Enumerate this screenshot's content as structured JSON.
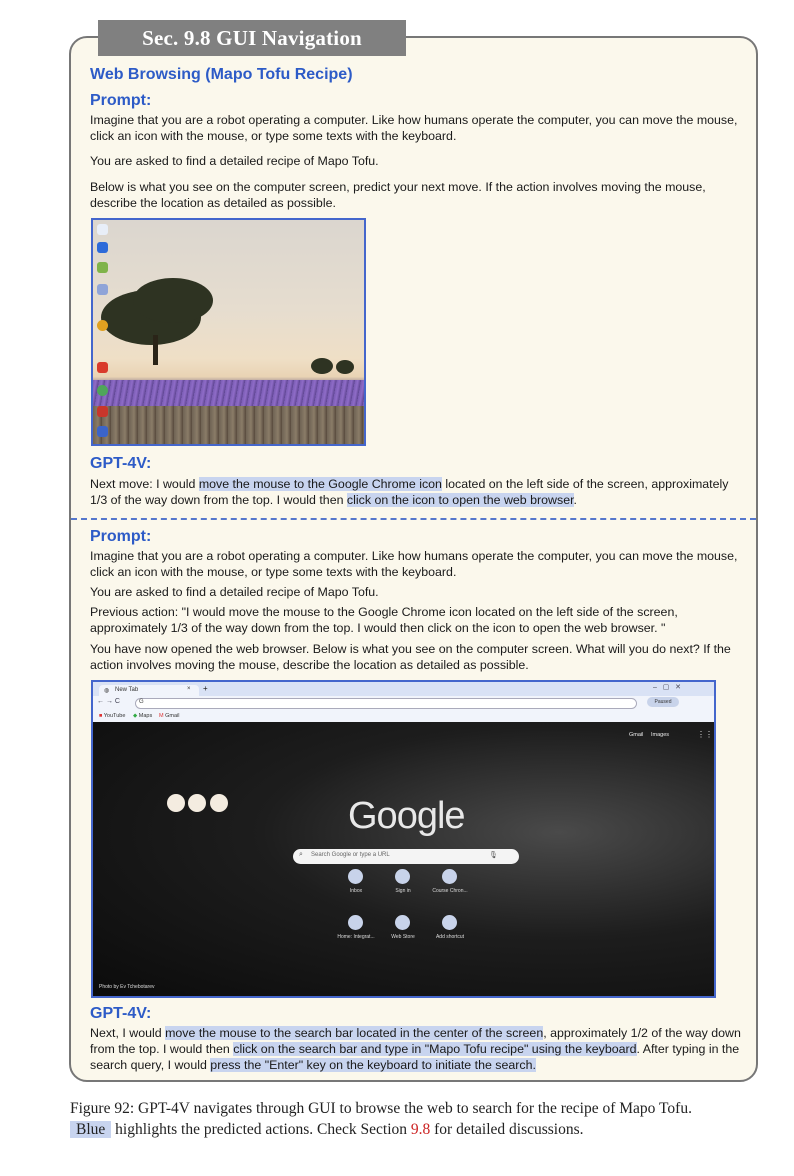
{
  "section_header": "Sec. 9.8 GUI Navigation",
  "task_title": "Web Browsing (Mapo Tofu Recipe)",
  "prompt_heading": "Prompt:",
  "gpt_heading": "GPT-4V:",
  "block1": {
    "p1": "Imagine that you are a robot operating a computer. Like how humans operate the computer, you can move the mouse, click an icon with the mouse, or type some texts with the keyboard.",
    "p2": "You are asked to find a detailed recipe of Mapo Tofu.",
    "p3": "Below is what you see on the computer screen, predict your next move. If the action involves moving the mouse, describe the location as detailed as possible.",
    "answer": {
      "a1": "Next move: I would ",
      "a2": "move the mouse to the Google Chrome icon",
      "a3": " located on the left side of the screen, approximately 1/3 of the way down from the top. I would then ",
      "a4": "click on the icon to open the web browser",
      "a5": "."
    }
  },
  "block2": {
    "p1": "Imagine that you are a robot operating a computer. Like how humans operate the computer, you can move the mouse, click an icon with the mouse, or type some texts with the keyboard.",
    "p2": "You are asked to find a detailed recipe of Mapo Tofu.",
    "p3": "Previous action: \"I would move the mouse to the Google Chrome icon located on the left side of the screen, approximately 1/3 of the way down from the top. I would then click on the icon to open the web browser. \"",
    "p4": "You have now opened the web browser. Below is what you see on the computer screen. What will you do next? If the action involves moving the mouse, describe the location as detailed as possible.",
    "answer": {
      "a1": "Next, I would ",
      "a2": "move the mouse to the search bar located in the center of the screen",
      "a3": ", approximately 1/2 of the way down from the top. I would then ",
      "a4": "click on the search bar and type in \"Mapo Tofu recipe\" using the keyboard",
      "a5": ". After typing in the search query, I would ",
      "a6": "press the \"Enter\" key on the keyboard to initiate the search."
    }
  },
  "browser": {
    "tab_title": "New Tab",
    "omni_text": "G",
    "bookmarks": [
      "YouTube",
      "Maps",
      "Gmail"
    ],
    "profile": "Paused",
    "top_links": [
      "Gmail",
      "Images"
    ],
    "logo": "Google",
    "search_placeholder": "Search Google or type a URL",
    "shortcuts": [
      "Inbox",
      "Sign in",
      "Course Chron...",
      "Home: Integrat...",
      "Web Store",
      "Add shortcut"
    ],
    "photo_credit": "Photo by Ev Tchebotarev"
  },
  "caption": {
    "c1": "Figure 92: GPT-4V navigates through GUI to browse the web to search for the recipe of Mapo Tofu.",
    "blue": "Blue",
    "c2": " highlights the predicted actions. Check Section ",
    "ref": "9.8",
    "c3": " for detailed discussions."
  },
  "colors": {
    "accent_blue": "#2d5bc7",
    "highlight": "#c8d4ef",
    "panel_bg": "#fbf8ec",
    "header_bg": "#808080"
  }
}
